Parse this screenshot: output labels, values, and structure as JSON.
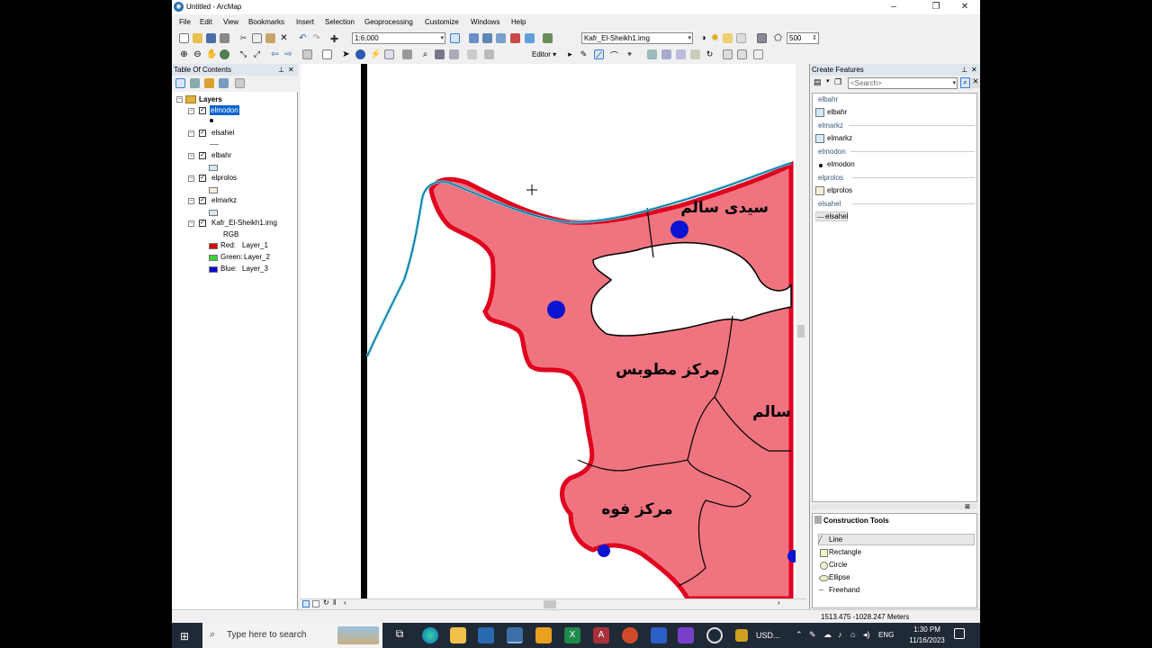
{
  "window": {
    "title": "Untitled - ArcMap",
    "minimize": "–",
    "maximize": "❐",
    "close": "✕"
  },
  "menu": [
    "File",
    "Edit",
    "View",
    "Bookmarks",
    "Insert",
    "Selection",
    "Geoprocessing",
    "Customize",
    "Windows",
    "Help"
  ],
  "toolbar": {
    "scale": "1:6,000",
    "layer_combo": "Kafr_El-Sheikh1.img",
    "zoom_value": "500",
    "editor_label": "Editor ▾"
  },
  "toc": {
    "title": "Table Of Contents",
    "root": "Layers",
    "layers": [
      {
        "name": "elmodon",
        "checked": true,
        "selected": true
      },
      {
        "name": "elsahel",
        "checked": true
      },
      {
        "name": "elbahr",
        "checked": true
      },
      {
        "name": "elprolos",
        "checked": true
      },
      {
        "name": "elmarkz",
        "checked": true
      },
      {
        "name": "Kafr_El-Sheikh1.img",
        "checked": true
      }
    ],
    "raster": {
      "rgb": "RGB",
      "bands": [
        {
          "label": "Red:",
          "layer": "Layer_1",
          "color": "#d80000"
        },
        {
          "label": "Green:",
          "layer": "Layer_2",
          "color": "#3ad23a"
        },
        {
          "label": "Blue:",
          "layer": "Layer_3",
          "color": "#0a0ad0"
        }
      ]
    }
  },
  "map": {
    "labels": {
      "sidi_salem": "سيدى سالم",
      "mutubas": "مركز مطوبس",
      "salem_partial": "سالم",
      "fuwwa": "مركز فوه"
    },
    "colors": {
      "polygon": "#f07480",
      "outline": "#e0001e",
      "coast": "#58c8e8",
      "points": "#0a14d0"
    }
  },
  "create_features": {
    "title": "Create Features",
    "search_placeholder": "<Search>",
    "groups": [
      {
        "header": "elbahr",
        "item": "elbahr"
      },
      {
        "header": "elmarkz",
        "item": "elmarkz"
      },
      {
        "header": "elmodon",
        "item": "elmodon"
      },
      {
        "header": "elprolos",
        "item": "elprolos"
      },
      {
        "header": "elsahel",
        "item": "elsahel"
      }
    ]
  },
  "construction_tools": {
    "title": "Construction Tools",
    "tools": [
      "Line",
      "Rectangle",
      "Circle",
      "Ellipse",
      "Freehand"
    ]
  },
  "status": {
    "coordinates": "1513.475  -1028.247 Meters"
  },
  "taskbar": {
    "search_placeholder": "Type here to search",
    "ticker": "USD...",
    "lang": "ENG",
    "time": "1:30 PM",
    "date": "11/16/2023"
  }
}
